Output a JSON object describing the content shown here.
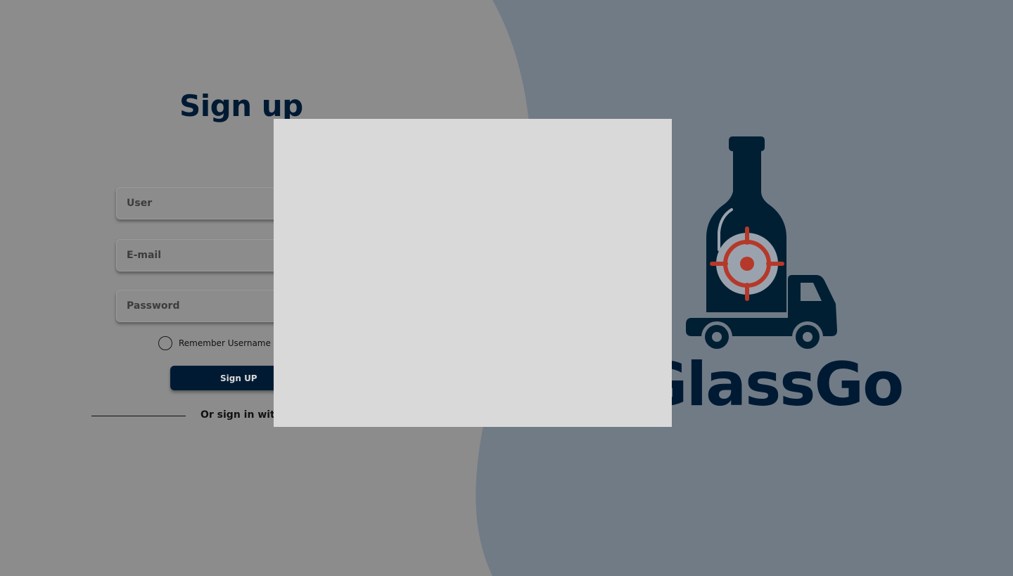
{
  "signup": {
    "title": "Sign up",
    "fields": {
      "user_placeholder": "User",
      "email_placeholder": "E-mail",
      "password_placeholder": "Password"
    },
    "remember_label": "Remember Username",
    "submit_label": "Sign UP",
    "alt_signin_label": "Or sign in with"
  },
  "brand": {
    "name": "GlassGo",
    "logo_icon": "bottle-truck-target-icon"
  },
  "overlay": {
    "icon": "blank-modal-panel"
  },
  "colors": {
    "left_background": "#8c8c8c",
    "right_background": "#717b86",
    "navy": "#001a33",
    "accent_red": "#b5392a",
    "overlay": "#d9d9d9"
  }
}
